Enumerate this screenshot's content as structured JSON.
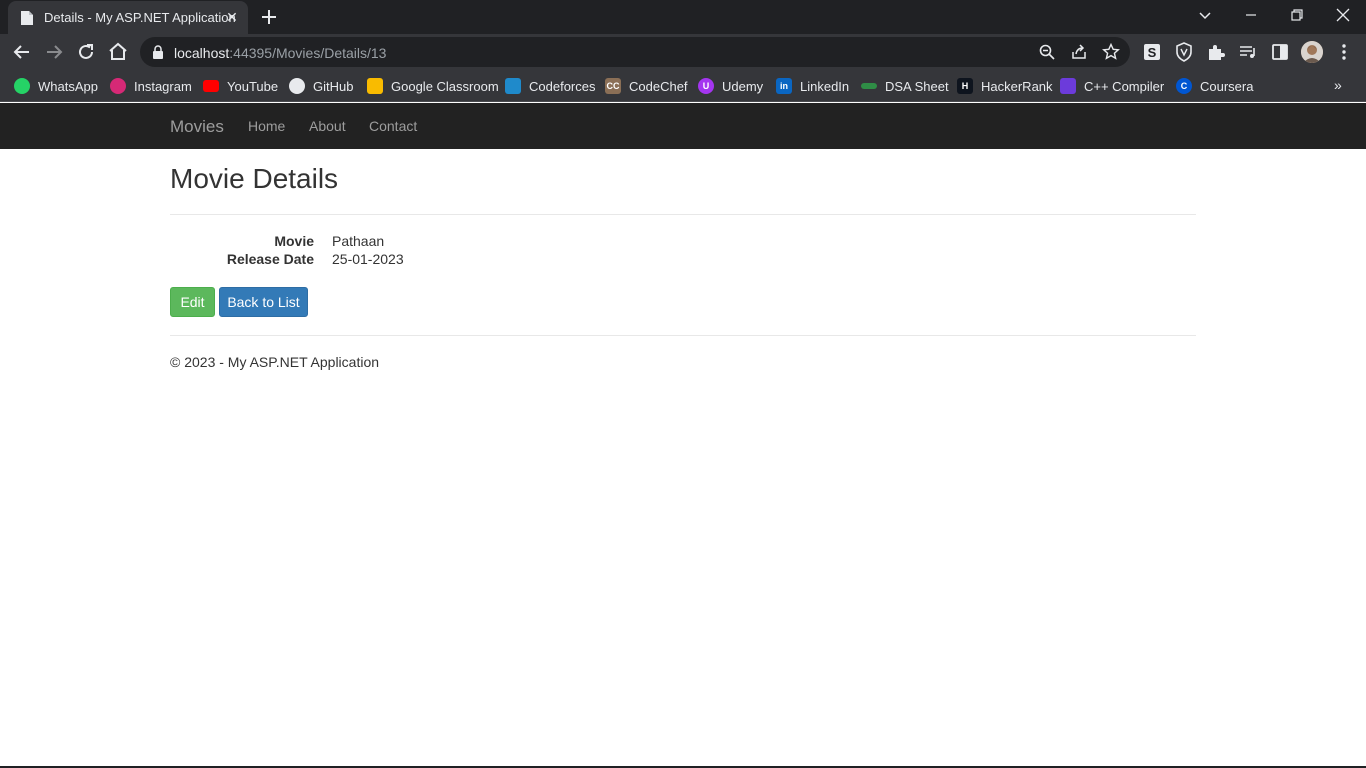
{
  "browser": {
    "tab_title": "Details - My ASP.NET Application",
    "tab_close": "✕",
    "url_host": "localhost",
    "url_rest": ":44395/Movies/Details/13"
  },
  "bookmarks": [
    {
      "label": "WhatsApp",
      "icon": "whatsapp-icon",
      "color": "#25d366",
      "glyph": ""
    },
    {
      "label": "Instagram",
      "icon": "instagram-icon",
      "color": "#d62976",
      "glyph": ""
    },
    {
      "label": "YouTube",
      "icon": "youtube-icon",
      "color": "#ff0000",
      "glyph": ""
    },
    {
      "label": "GitHub",
      "icon": "github-icon",
      "color": "#e8eaed",
      "glyph": ""
    },
    {
      "label": "Google Classroom",
      "icon": "google-classroom-icon",
      "color": "#f9bb00",
      "glyph": ""
    },
    {
      "label": "Codeforces",
      "icon": "codeforces-icon",
      "color": "#1f8acb",
      "glyph": ""
    },
    {
      "label": "CodeChef",
      "icon": "codechef-icon",
      "color": "#8b6f56",
      "glyph": "CC"
    },
    {
      "label": "Udemy",
      "icon": "udemy-icon",
      "color": "#a435f0",
      "glyph": "U"
    },
    {
      "label": "LinkedIn",
      "icon": "linkedin-icon",
      "color": "#0a66c2",
      "glyph": "in"
    },
    {
      "label": "DSA Sheet",
      "icon": "dsa-sheet-icon",
      "color": "#2f8d46",
      "glyph": ""
    },
    {
      "label": "HackerRank",
      "icon": "hackerrank-icon",
      "color": "#0e141e",
      "glyph": "H"
    },
    {
      "label": "C++ Compiler",
      "icon": "cpp-compiler-icon",
      "color": "#6c3bdb",
      "glyph": ""
    },
    {
      "label": "Coursera",
      "icon": "coursera-icon",
      "color": "#0056d2",
      "glyph": "C"
    }
  ],
  "navbar": {
    "brand": "Movies",
    "links": [
      "Home",
      "About",
      "Contact"
    ]
  },
  "details": {
    "title": "Movie Details",
    "fields": [
      {
        "label": "Movie",
        "value": "Pathaan"
      },
      {
        "label": "Release Date",
        "value": "25-01-2023"
      }
    ],
    "edit_label": "Edit",
    "back_label": "Back to List"
  },
  "footer": {
    "text": "© 2023 - My ASP.NET Application"
  }
}
